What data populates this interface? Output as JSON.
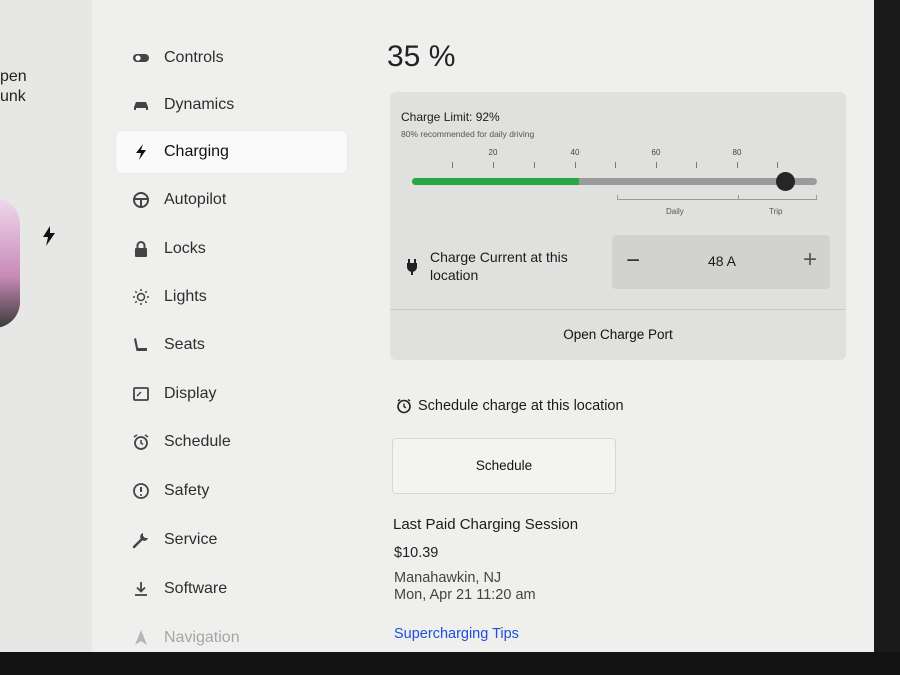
{
  "car_view": {
    "labels": [
      "pen",
      "unk"
    ]
  },
  "menu": {
    "items": [
      {
        "label": "Controls",
        "icon": "toggle-icon",
        "active": false
      },
      {
        "label": "Dynamics",
        "icon": "car-icon",
        "active": false
      },
      {
        "label": "Charging",
        "icon": "bolt-icon",
        "active": true
      },
      {
        "label": "Autopilot",
        "icon": "steering-wheel-icon",
        "active": false
      },
      {
        "label": "Locks",
        "icon": "lock-icon",
        "active": false
      },
      {
        "label": "Lights",
        "icon": "sun-icon",
        "active": false
      },
      {
        "label": "Seats",
        "icon": "seat-icon",
        "active": false
      },
      {
        "label": "Display",
        "icon": "display-icon",
        "active": false
      },
      {
        "label": "Schedule",
        "icon": "alarm-clock-icon",
        "active": false
      },
      {
        "label": "Safety",
        "icon": "alert-circle-icon",
        "active": false
      },
      {
        "label": "Service",
        "icon": "wrench-icon",
        "active": false
      },
      {
        "label": "Software",
        "icon": "download-icon",
        "active": false
      },
      {
        "label": "Navigation",
        "icon": "navigation-icon",
        "active": false
      }
    ]
  },
  "battery": {
    "percent_text": "35 %"
  },
  "charge_limit": {
    "title": "Charge Limit: 92%",
    "subtitle": "80% recommended for daily driving",
    "value_percent": 92,
    "current_level_percent": 35,
    "tick_labels": [
      "20",
      "40",
      "60",
      "80"
    ],
    "range_labels": {
      "daily": "Daily",
      "trip": "Trip"
    }
  },
  "charge_current": {
    "label": "Charge Current at this location",
    "value": "48 A",
    "minus": "−",
    "plus": "+"
  },
  "open_charge_port": {
    "label": "Open Charge Port"
  },
  "schedule": {
    "row_label": "Schedule charge at this location",
    "button_label": "Schedule"
  },
  "last_session": {
    "title": "Last Paid Charging Session",
    "amount": "$10.39",
    "location": "Manahawkin, NJ",
    "datetime": "Mon, Apr 21 11:20 am"
  },
  "links": {
    "supercharging_tips": "Supercharging Tips"
  },
  "colors": {
    "accent_green": "#28a745",
    "link_blue": "#1f4fd8"
  }
}
